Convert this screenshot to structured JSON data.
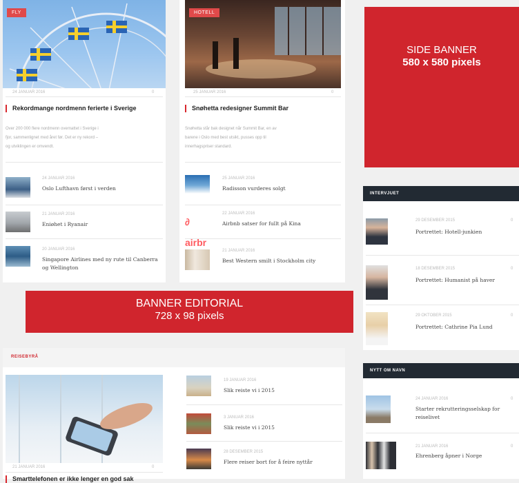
{
  "col1": {
    "featured": {
      "category": "FLY",
      "date": "24 JANUAR 2016",
      "count": "0",
      "headline": "Rekordmange nordmenn feriertе i Sverige",
      "excerpt": [
        "Over 200 000 flere nordmenn overnattet i Sverige i",
        "fjor, sammenlignet med året før. Det er ny rekord –",
        "og utviklingen er omvendt."
      ]
    },
    "items": [
      {
        "date": "24 JANUAR 2016",
        "title": "Oslo Lufthavn først i verden"
      },
      {
        "date": "21 JANUAR 2016",
        "title": "Eniøhet i Ryanair"
      },
      {
        "date": "20 JANUAR 2016",
        "title": "Singapore Airlines med ny rute til Canberra og Wellington"
      }
    ]
  },
  "col2": {
    "featured": {
      "category": "HOTELL",
      "date": "25 JANUAR 2016",
      "count": "0",
      "headline": "Snøhetta redesigner Summit Bar",
      "excerpt": [
        "Snøhetta står bak designet når Summit Bar, en av",
        "barene i Oslo med best utsikt, pusses opp til",
        "innerhagspriser standard."
      ]
    },
    "items": [
      {
        "date": "25 JANUAR 2016",
        "title": "Radisson vurderes solgt"
      },
      {
        "date": "22 JANUAR 2016",
        "title": "Airbnb satser for fullt på Kina"
      },
      {
        "date": "21 JANUAR 2016",
        "title": "Best Western smilt i Stockholm city"
      }
    ]
  },
  "side_banner": {
    "line1": "SIDE BANNER",
    "line2": "580 x 580 pixels"
  },
  "editorial_banner": {
    "line1": "BANNER EDITORIAL",
    "line2": "728 x 98 pixels"
  },
  "intervjuet": {
    "heading": "INTERVJUET",
    "items": [
      {
        "date": "29 DESEMBER 2015",
        "title": "Portrettet: Hotell-junkien",
        "count": "0"
      },
      {
        "date": "18 DESEMBER 2015",
        "title": "Portrettet: Humanist på haver",
        "count": "0"
      },
      {
        "date": "29 OKTOBER 2015",
        "title": "Portrettet: Cathrine Pia Lund",
        "count": "0"
      }
    ]
  },
  "nytt_om_navn": {
    "heading": "NYTT OM NAVN",
    "items": [
      {
        "date": "24 JANUAR 2016",
        "title": "Starter rekrutteringsselskap for reiselivet",
        "count": "0"
      },
      {
        "date": "21 JANUAR 2016",
        "title": "Ehrenberg åpner i Norge",
        "count": "0"
      }
    ]
  },
  "reisebyra": {
    "heading": "REISEBYRÅ",
    "featured": {
      "date": "21 JANUAR 2016",
      "count": "0",
      "headline": "Smarttelefonen er ikke lenger en god sak"
    },
    "items": [
      {
        "date": "19 JANUAR 2016",
        "title": "Slik reiste vi i 2015"
      },
      {
        "date": "3 JANUAR 2016",
        "title": "Slik reiste vi i 2015"
      },
      {
        "date": "28 DESEMBER 2015",
        "title": "Flere reiser bort for å feire nyttår"
      }
    ]
  },
  "colors": {
    "accent": "#d0252d",
    "section_header": "#222a33"
  }
}
